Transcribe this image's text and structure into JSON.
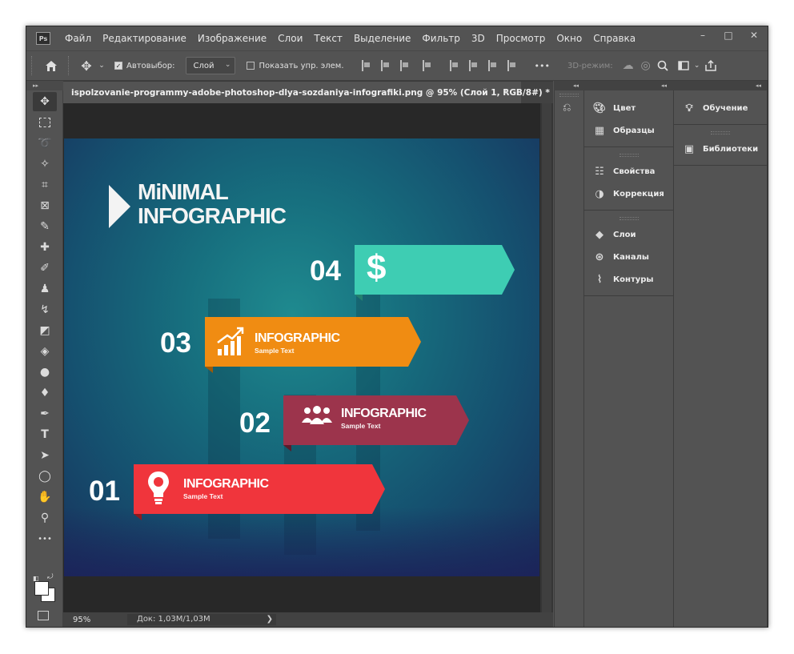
{
  "menubar": {
    "logo": "Ps",
    "items": [
      "Файл",
      "Редактирование",
      "Изображение",
      "Слои",
      "Текст",
      "Выделение",
      "Фильтр",
      "3D",
      "Просмотр",
      "Окно",
      "Справка"
    ]
  },
  "window_controls": {
    "minimize": "–",
    "maximize": "□",
    "close": "✕"
  },
  "options_bar": {
    "autoselect_label": "Автовыбор:",
    "autoselect_value": "Слой",
    "show_transform_label": "Показать упр. элем.",
    "more_label": "•••",
    "mode_3d_label": "3D-режим:"
  },
  "document": {
    "tab_title": "ispolzovanie-programmy-adobe-photoshop-dlya-sozdaniya-infografiki.png @ 95% (Слой 1, RGB/8#) *",
    "close_glyph": "✕",
    "zoom": "95%",
    "doc_info": "Док: 1,03M/1,03M",
    "info_arrow": "❯"
  },
  "image": {
    "title_line1": "MiNIMAL",
    "title_line2": "INFOGRAPHIC",
    "steps": [
      {
        "number": "04",
        "icon": "dollar-icon",
        "title": "",
        "subtitle": "",
        "color": "#3ecdb3"
      },
      {
        "number": "03",
        "icon": "growth-chart-icon",
        "title": "INFOGRAPHIC",
        "subtitle": "Sample Text",
        "color": "#f08c12"
      },
      {
        "number": "02",
        "icon": "people-group-icon",
        "title": "INFOGRAPHIC",
        "subtitle": "Sample Text",
        "color": "#9c344c"
      },
      {
        "number": "01",
        "icon": "lightbulb-icon",
        "title": "INFOGRAPHIC",
        "subtitle": "Sample Text",
        "color": "#f0353c"
      }
    ]
  },
  "panels": {
    "group_a": [
      {
        "label": "Цвет",
        "icon": "palette-icon"
      },
      {
        "label": "Образцы",
        "icon": "swatches-grid-icon"
      }
    ],
    "group_b": [
      {
        "label": "Свойства",
        "icon": "properties-icon"
      },
      {
        "label": "Коррекция",
        "icon": "adjustments-icon"
      }
    ],
    "group_c": [
      {
        "label": "Слои",
        "icon": "layers-icon"
      },
      {
        "label": "Каналы",
        "icon": "channels-icon"
      },
      {
        "label": "Контуры",
        "icon": "paths-icon"
      }
    ],
    "right_col": [
      {
        "label": "Обучение",
        "icon": "lightbulb-icon"
      },
      {
        "label": "Библиотеки",
        "icon": "libraries-icon"
      }
    ]
  }
}
